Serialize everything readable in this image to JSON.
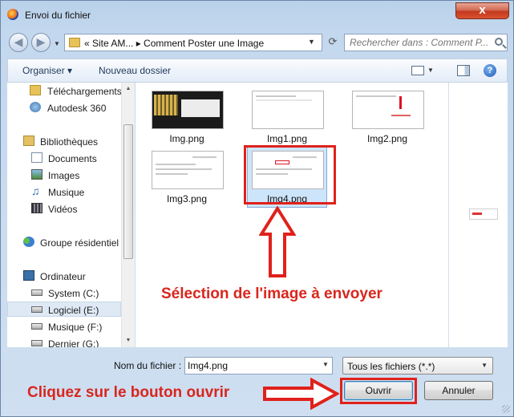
{
  "window": {
    "title": "Envoi du fichier",
    "close_glyph": "x"
  },
  "address_bar": {
    "path": "« Site AM... ▸ Comment Poster une Image"
  },
  "search": {
    "placeholder": "Rechercher dans : Comment P..."
  },
  "toolbar": {
    "organise_label": "Organiser ▾",
    "new_folder_label": "Nouveau dossier"
  },
  "nav_pane": {
    "items": [
      {
        "label": "Téléchargements",
        "icon": "download-folder-icon"
      },
      {
        "label": "Autodesk 360",
        "icon": "cloud-icon"
      },
      {
        "label": "Bibliothèques",
        "icon": "libraries-icon"
      },
      {
        "label": "Documents",
        "icon": "documents-icon"
      },
      {
        "label": "Images",
        "icon": "pictures-icon"
      },
      {
        "label": "Musique",
        "icon": "music-icon"
      },
      {
        "label": "Vidéos",
        "icon": "videos-icon"
      },
      {
        "label": "Groupe résidentiel",
        "icon": "homegroup-icon"
      },
      {
        "label": "Ordinateur",
        "icon": "computer-icon"
      },
      {
        "label": "System (C:)",
        "icon": "drive-icon"
      },
      {
        "label": "Logiciel (E:)",
        "icon": "drive-icon",
        "selected": true
      },
      {
        "label": "Musique (F:)",
        "icon": "drive-icon"
      },
      {
        "label": "Dernier (G:)",
        "icon": "drive-icon"
      }
    ]
  },
  "files": [
    {
      "name": "Img.png"
    },
    {
      "name": "Img1.png"
    },
    {
      "name": "Img2.png"
    },
    {
      "name": "Img3.png"
    },
    {
      "name": "Img4.png",
      "selected": true
    }
  ],
  "annotations": {
    "selection_text": "Sélection de l'image à envoyer",
    "open_text": "Cliquez sur le bouton ouvrir",
    "color": "#d8261d"
  },
  "bottom": {
    "filename_label": "Nom du fichier :",
    "filename_value": "Img4.png",
    "filetype_value": "Tous les fichiers (*.*)",
    "open_label": "Ouvrir",
    "cancel_label": "Annuler"
  }
}
